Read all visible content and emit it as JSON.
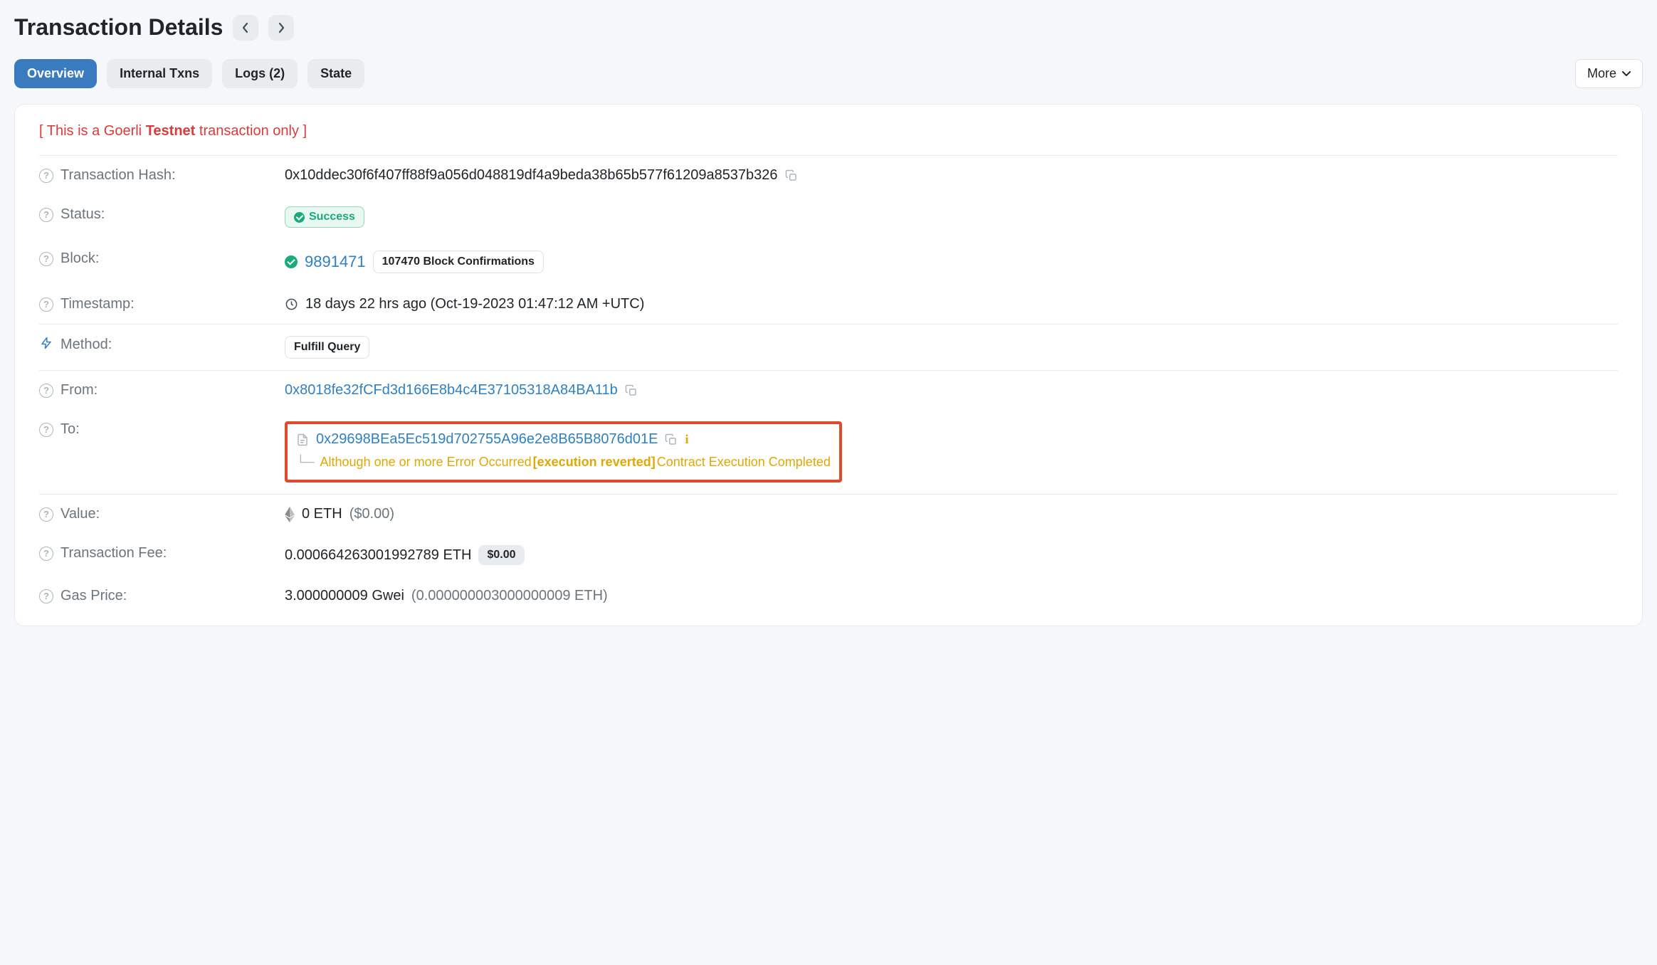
{
  "page_title": "Transaction Details",
  "tabs": {
    "overview": "Overview",
    "internal": "Internal Txns",
    "logs": "Logs (2)",
    "state": "State"
  },
  "more_label": "More",
  "notice": {
    "prefix": "[ This is a Goerli ",
    "bold": "Testnet",
    "suffix": " transaction only ]"
  },
  "labels": {
    "hash": "Transaction Hash:",
    "status": "Status:",
    "block": "Block:",
    "timestamp": "Timestamp:",
    "method": "Method:",
    "from": "From:",
    "to": "To:",
    "value": "Value:",
    "fee": "Transaction Fee:",
    "gas": "Gas Price:"
  },
  "hash": "0x10ddec30f6f407ff88f9a056d048819df4a9beda38b65b577f61209a8537b326",
  "status": "Success",
  "block_number": "9891471",
  "block_confirmations": "107470 Block Confirmations",
  "timestamp": "18 days 22 hrs ago (Oct-19-2023 01:47:12 AM +UTC)",
  "method": "Fulfill Query",
  "from": "0x8018fe32fCFd3d166E8b4c4E37105318A84BA11b",
  "to": "0x29698BEa5Ec519d702755A96e2e8B65B8076d01E",
  "to_error": {
    "p1": "Although one or more Error Occurred ",
    "p2": "[execution reverted]",
    "p3": " Contract Execution Completed"
  },
  "value_eth": "0 ETH",
  "value_usd": "($0.00)",
  "fee_eth": "0.000664263001992789 ETH",
  "fee_usd": "$0.00",
  "gas_gwei": "3.000000009 Gwei",
  "gas_eth": "(0.000000003000000009 ETH)"
}
